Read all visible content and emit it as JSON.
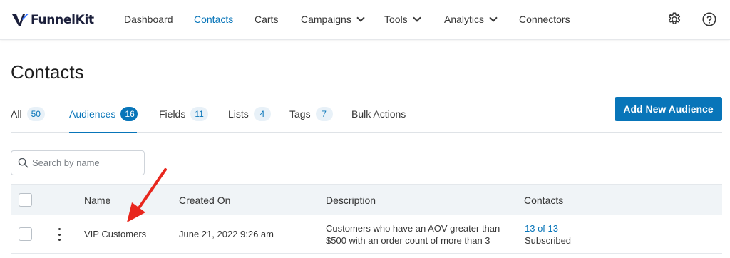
{
  "brand": {
    "name": "FunnelKit",
    "logo_color": "#1b1f3b",
    "accent_color": "#3a77ff"
  },
  "nav": {
    "items": [
      {
        "label": "Dashboard",
        "active": false,
        "dropdown": false
      },
      {
        "label": "Contacts",
        "active": true,
        "dropdown": false
      },
      {
        "label": "Carts",
        "active": false,
        "dropdown": false
      },
      {
        "label": "Campaigns",
        "active": false,
        "dropdown": true
      },
      {
        "label": "Tools",
        "active": false,
        "dropdown": true
      },
      {
        "label": "Analytics",
        "active": false,
        "dropdown": true
      },
      {
        "label": "Connectors",
        "active": false,
        "dropdown": false
      }
    ],
    "icons": [
      "gear-icon",
      "help-circle-icon"
    ],
    "active_color": "#0875b9"
  },
  "page": {
    "title": "Contacts"
  },
  "tabs": [
    {
      "label": "All",
      "count": "50",
      "active": false
    },
    {
      "label": "Audiences",
      "count": "16",
      "active": true
    },
    {
      "label": "Fields",
      "count": "11",
      "active": false
    },
    {
      "label": "Lists",
      "count": "4",
      "active": false
    },
    {
      "label": "Tags",
      "count": "7",
      "active": false
    },
    {
      "label": "Bulk Actions",
      "count": null,
      "active": false
    }
  ],
  "actions": {
    "add_audience_label": "Add New Audience",
    "primary_color": "#0875b9"
  },
  "search": {
    "placeholder": "Search by name",
    "value": ""
  },
  "table": {
    "columns": [
      "Name",
      "Created On",
      "Description",
      "Contacts"
    ],
    "rows": [
      {
        "name": "VIP Customers",
        "created_on": "June 21, 2022 9:26 am",
        "description_line1": "Customers who have an AOV greater than",
        "description_line2": "$500 with an order count of more than 3",
        "contacts_link": "13 of 13",
        "contacts_status": "Subscribed"
      }
    ]
  },
  "annotation": {
    "arrow_color": "#e8271e"
  }
}
